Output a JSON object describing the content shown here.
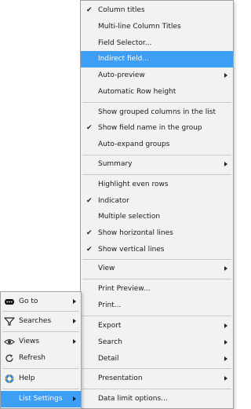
{
  "colors": {
    "highlight": "#3d9ef5",
    "menu_bg": "#f2f2f2",
    "separator": "#c8c8c8"
  },
  "submenu": {
    "items": [
      {
        "label": "Column titles",
        "checked": true
      },
      {
        "label": "Multi-line Column Titles"
      },
      {
        "label": "Field Selector..."
      },
      {
        "label": "Indirect field...",
        "highlighted": true
      },
      {
        "label": "Auto-preview",
        "has_submenu": true
      },
      {
        "label": "Automatic Row height"
      },
      {
        "label": "Show grouped columns in the list"
      },
      {
        "label": "Show field name in the group",
        "checked": true
      },
      {
        "label": "Auto-expand groups"
      },
      {
        "label": "Summary",
        "has_submenu": true
      },
      {
        "label": "Highlight even rows"
      },
      {
        "label": "Indicator",
        "checked": true
      },
      {
        "label": "Multiple selection"
      },
      {
        "label": "Show horizontal lines",
        "checked": true
      },
      {
        "label": "Show vertical lines",
        "checked": true
      },
      {
        "label": "View",
        "has_submenu": true
      },
      {
        "label": "Print Preview..."
      },
      {
        "label": "Print..."
      },
      {
        "label": "Export",
        "has_submenu": true
      },
      {
        "label": "Search",
        "has_submenu": true
      },
      {
        "label": "Detail",
        "has_submenu": true
      },
      {
        "label": "Presentation",
        "has_submenu": true
      },
      {
        "label": "Data limit options..."
      }
    ]
  },
  "context_menu": {
    "items": [
      {
        "label": "Go to",
        "icon": "goto-icon",
        "has_submenu": true
      },
      {
        "label": "Searches",
        "icon": "filter-icon",
        "has_submenu": true
      },
      {
        "label": "Views",
        "icon": "eye-icon",
        "has_submenu": true
      },
      {
        "label": "Refresh",
        "icon": "refresh-icon"
      },
      {
        "label": "Help",
        "icon": "help-icon"
      },
      {
        "label": "List Settings",
        "has_submenu": true,
        "highlighted": true
      }
    ]
  }
}
